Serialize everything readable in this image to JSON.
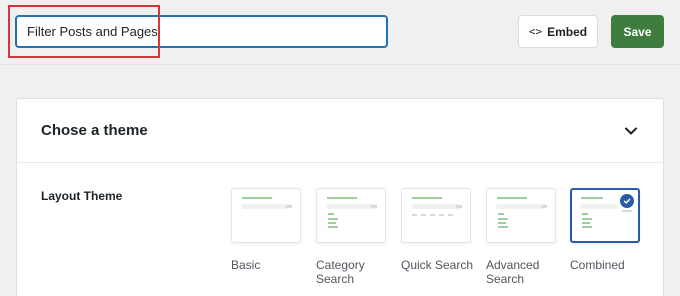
{
  "header": {
    "title_value": "Filter Posts and Pages",
    "embed_label": "Embed",
    "embed_icon": "code-icon",
    "save_label": "Save"
  },
  "panel": {
    "title": "Chose a theme",
    "layout_label": "Layout Theme",
    "themes": [
      {
        "label": "Basic",
        "selected": false
      },
      {
        "label": "Category Search",
        "selected": false
      },
      {
        "label": "Quick Search",
        "selected": false
      },
      {
        "label": "Advanced Search",
        "selected": false
      },
      {
        "label": "Combined",
        "selected": true
      }
    ]
  },
  "colors": {
    "accent": "#2271b1",
    "save": "#3e7d3e",
    "selected": "#2b5aa6",
    "highlight": "#d63638"
  }
}
